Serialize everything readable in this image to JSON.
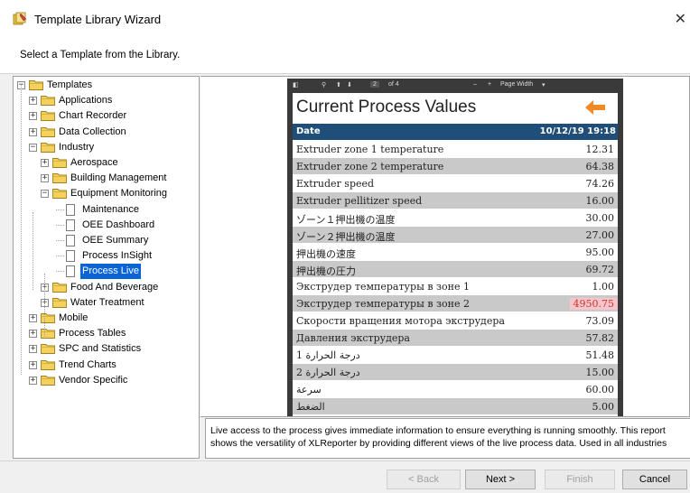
{
  "window": {
    "title": "Template Library Wizard",
    "close_glyph": "✕",
    "icon": "wizard-icon"
  },
  "header": {
    "subtitle": "Select a Template from the Library."
  },
  "tree": {
    "nodes": [
      {
        "label": "Templates"
      },
      {
        "label": "Applications"
      },
      {
        "label": "Chart Recorder"
      },
      {
        "label": "Data Collection"
      },
      {
        "label": "Industry"
      },
      {
        "label": "Aerospace"
      },
      {
        "label": "Building Management"
      },
      {
        "label": "Equipment Monitoring"
      },
      {
        "label": "Maintenance"
      },
      {
        "label": "OEE Dashboard"
      },
      {
        "label": "OEE Summary"
      },
      {
        "label": "Process InSight"
      },
      {
        "label": "Process Live"
      },
      {
        "label": "Food And Beverage"
      },
      {
        "label": "Water Treatment"
      },
      {
        "label": "Mobile"
      },
      {
        "label": "Process Tables"
      },
      {
        "label": "SPC and Statistics"
      },
      {
        "label": "Trend Charts"
      },
      {
        "label": "Vendor Specific"
      }
    ],
    "selected": "Process Live"
  },
  "viewer_toolbar": {
    "page": "2",
    "page_of": "of 4",
    "minus": "–",
    "plus": "+",
    "zoom": "Page Width"
  },
  "report": {
    "title": "Current Process Values",
    "header_label": "Date",
    "header_value": "10/12/19 19:18",
    "rows": [
      {
        "name": "Extruder zone 1 temperature",
        "value": "12.31"
      },
      {
        "name": "Extruder zone 2 temperature",
        "value": "64.38"
      },
      {
        "name": "Extruder speed",
        "value": "74.26"
      },
      {
        "name": "Extruder pellitizer speed",
        "value": "16.00"
      },
      {
        "name": "ゾーン１押出機の温度",
        "value": "30.00"
      },
      {
        "name": "ゾーン２押出機の温度",
        "value": "27.00"
      },
      {
        "name": "押出機の速度",
        "value": "95.00"
      },
      {
        "name": "押出機の圧力",
        "value": "69.72"
      },
      {
        "name": "Экструдер температуры в зоне 1",
        "value": "1.00"
      },
      {
        "name": "Экструдер температуры в зоне 2",
        "value": "4950.75"
      },
      {
        "name": "Скорости вращения мотора экструдера",
        "value": "73.09"
      },
      {
        "name": "Давления экструдера",
        "value": "57.82"
      },
      {
        "name": "درجة الحرارة 1",
        "value": "51.48"
      },
      {
        "name": "درجة الحرارة 2",
        "value": "15.00"
      },
      {
        "name": "سرعة",
        "value": "60.00"
      },
      {
        "name": "الضغط",
        "value": "5.00"
      }
    ],
    "alarm_color": "#f8c5cc"
  },
  "description": {
    "line1": "Live access to the process gives immediate information to ensure everything is running smoothly. This report",
    "line2": "shows the versatility of XLReporter by providing different views of the live process data. Used in all industries"
  },
  "buttons": {
    "back": "< Back",
    "next": "Next >",
    "finish": "Finish",
    "cancel": "Cancel"
  },
  "colors": {
    "selection": "#0a64d6",
    "report_header": "#1f4e79",
    "folder": "#f3d15c"
  }
}
